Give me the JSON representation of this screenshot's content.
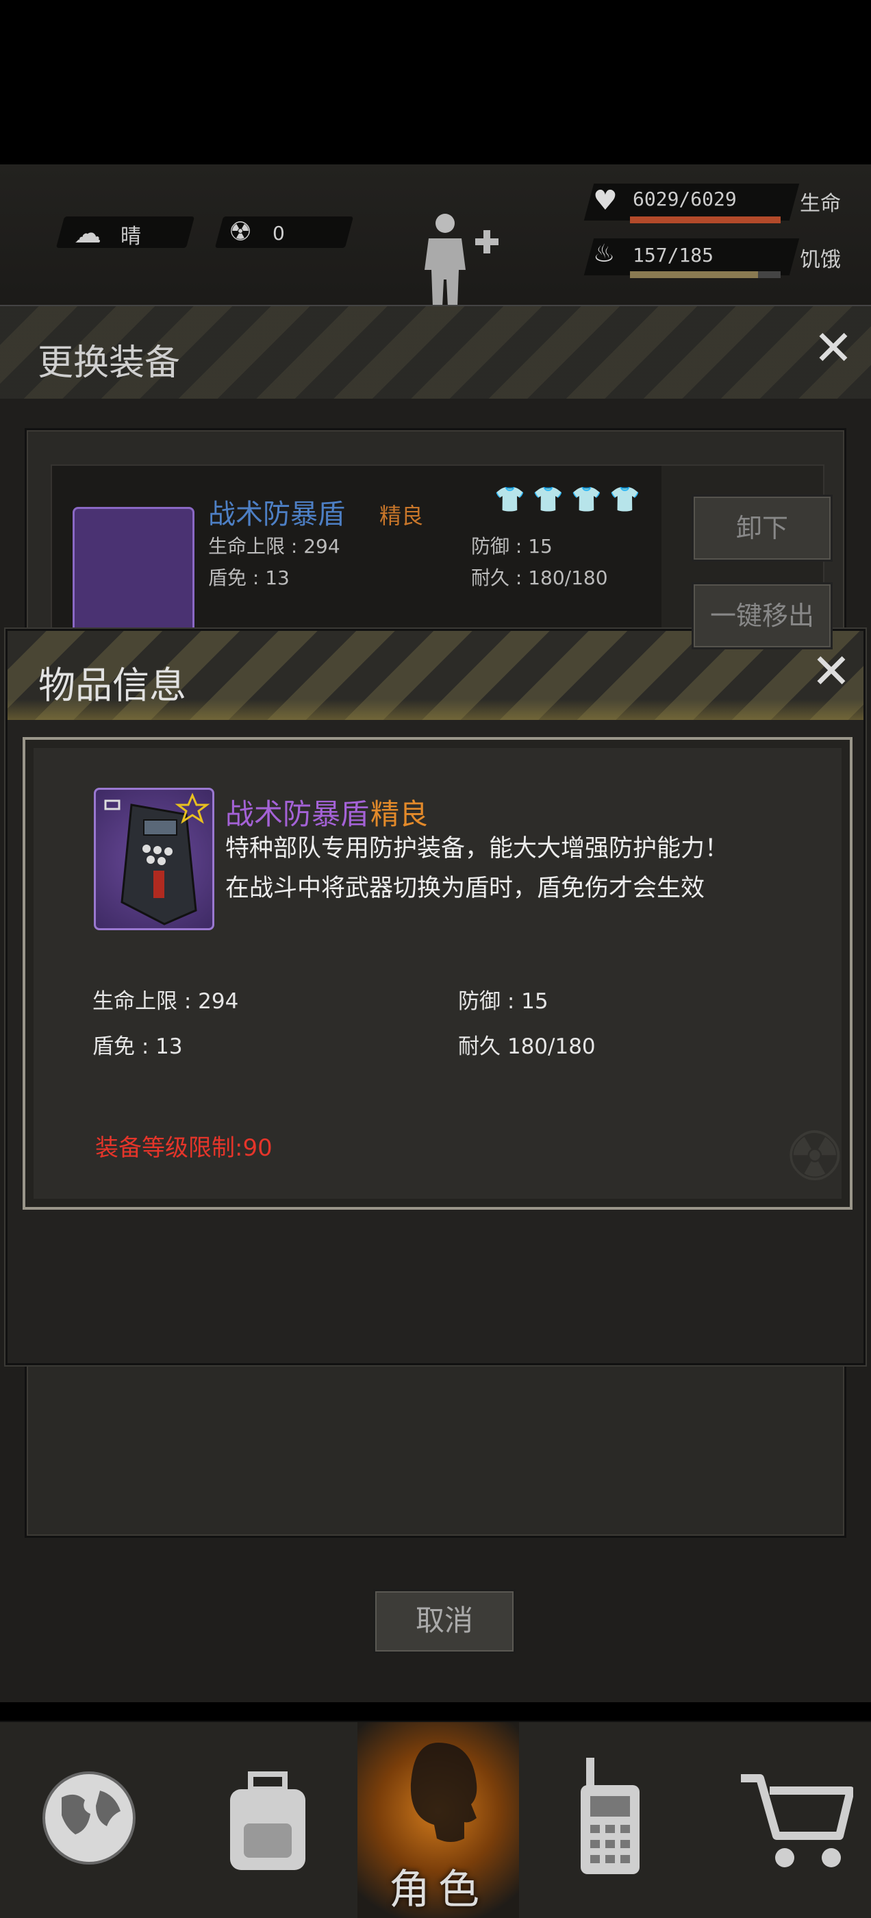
{
  "hud": {
    "weather_label": "晴",
    "radiation_value": "0",
    "stats": [
      {
        "value": "6029/6029",
        "label": "生命",
        "fill": 1.0,
        "color": "#b34a2a"
      },
      {
        "value": "157/185",
        "label": "饥饿",
        "fill": 0.85,
        "color": "#8a7a52"
      }
    ]
  },
  "equip_dialog": {
    "title": "更换装备",
    "item": {
      "name": "战术防暴盾",
      "grade": "精良",
      "stats": {
        "hp_max": "生命上限 : 294",
        "shield": "盾免 : 13",
        "defense": "防御 : 15",
        "durability": "耐久 : 180/180"
      }
    },
    "buttons": {
      "unequip": "卸下",
      "remove_all": "一键移出"
    },
    "cancel_label": "取消"
  },
  "info_dialog": {
    "title": "物品信息",
    "item_name": "战术防暴盾",
    "item_grade": "精良",
    "description": [
      "特种部队专用防护装备，能大大增强防护能力！",
      "在战斗中将武器切换为盾时，盾免伤才会生效"
    ],
    "stats": {
      "hp_max": "生命上限 : 294",
      "defense": "防御 : 15",
      "shield": "盾免 : 13",
      "durability": "耐久 180/180"
    },
    "level_requirement": "装备等级限制:90"
  },
  "bottom_nav": {
    "active_label": "角色",
    "active_index": 2
  },
  "colors": {
    "grade_orange": "#e38a2a",
    "item_purple": "#a462d6",
    "warning_red": "#e5352a"
  }
}
